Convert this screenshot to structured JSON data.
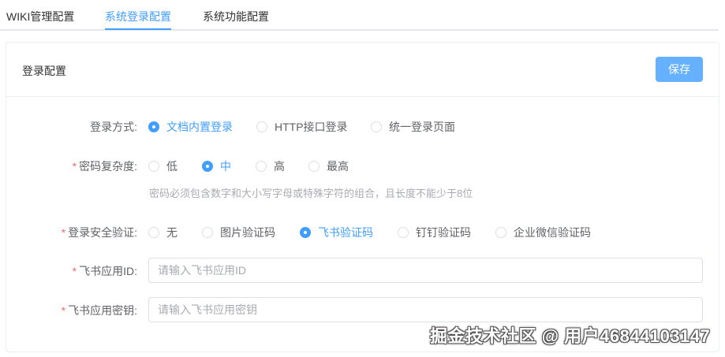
{
  "tabs": [
    {
      "label": "WIKI管理配置",
      "active": false
    },
    {
      "label": "系统登录配置",
      "active": true
    },
    {
      "label": "系统功能配置",
      "active": false
    }
  ],
  "card": {
    "title": "登录配置",
    "save_label": "保存"
  },
  "login_method": {
    "label": "登录方式:",
    "required": false,
    "options": [
      "文档内置登录",
      "HTTP接口登录",
      "统一登录页面"
    ],
    "selected": "文档内置登录"
  },
  "password_complexity": {
    "label": "密码复杂度:",
    "required": true,
    "options": [
      "低",
      "中",
      "高",
      "最高"
    ],
    "selected": "中",
    "hint": "密码必须包含数字和大小写字母或特殊字符的组合，且长度不能少于8位"
  },
  "login_verification": {
    "label": "登录安全验证:",
    "required": true,
    "options": [
      "无",
      "图片验证码",
      "飞书验证码",
      "钉钉验证码",
      "企业微信验证码"
    ],
    "selected": "飞书验证码"
  },
  "feishu_app_id": {
    "label": "飞书应用ID:",
    "required": true,
    "value": "",
    "placeholder": "请输入飞书应用ID"
  },
  "feishu_app_secret": {
    "label": "飞书应用密钥:",
    "required": true,
    "value": "",
    "placeholder": "请输入飞书应用密钥"
  },
  "watermark": "掘金技术社区 @ 用户46844103147",
  "colors": {
    "primary": "#409eff",
    "save_button": "#66b1ff",
    "required_asterisk": "#f56c6c",
    "border": "#dcdfe6"
  }
}
